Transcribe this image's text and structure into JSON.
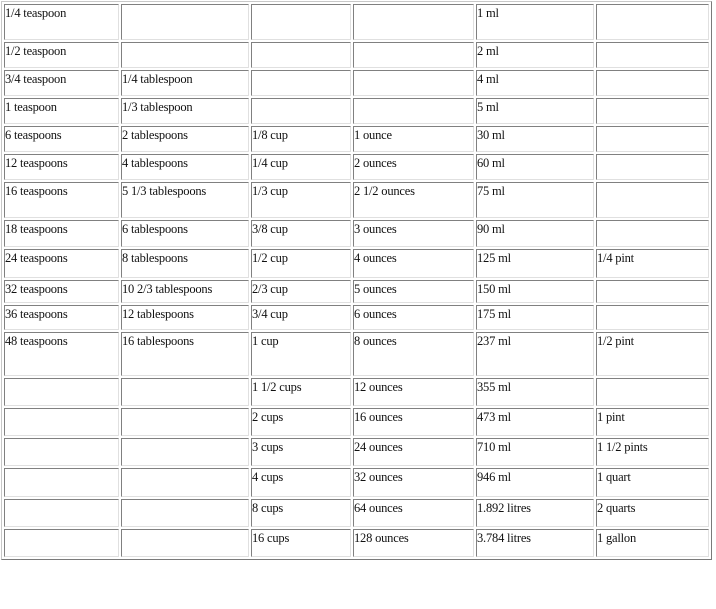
{
  "table": {
    "rows": [
      {
        "cells": [
          "1/4 teaspoon",
          "",
          "",
          "",
          "1 ml",
          ""
        ]
      },
      {
        "cells": [
          "1/2 teaspoon",
          "",
          "",
          "",
          "2 ml",
          ""
        ]
      },
      {
        "cells": [
          "3/4 teaspoon",
          "1/4 tablespoon",
          "",
          "",
          "4 ml",
          ""
        ]
      },
      {
        "cells": [
          "1 teaspoon",
          "1/3 tablespoon",
          "",
          "",
          "5 ml",
          ""
        ]
      },
      {
        "cells": [
          "6 teaspoons",
          "2 tablespoons",
          "1/8 cup",
          "1 ounce",
          "30 ml",
          ""
        ]
      },
      {
        "cells": [
          "12 teaspoons",
          "4 tablespoons",
          "1/4 cup",
          "2 ounces",
          "60 ml",
          ""
        ]
      },
      {
        "cells": [
          "16 teaspoons",
          "5 1/3 tablespoons",
          "1/3 cup",
          "2 1/2 ounces",
          "75 ml",
          ""
        ]
      },
      {
        "cells": [
          "18 teaspoons",
          "6 tablespoons",
          "3/8 cup",
          "3 ounces",
          "90 ml",
          ""
        ]
      },
      {
        "cells": [
          "24 teaspoons",
          "8 tablespoons",
          "1/2 cup",
          "4 ounces",
          "125 ml",
          "1/4 pint"
        ]
      },
      {
        "cells": [
          "32 teaspoons",
          "10 2/3 tablespoons",
          "2/3 cup",
          "5 ounces",
          "150 ml",
          ""
        ]
      },
      {
        "cells": [
          "36 teaspoons",
          "12 tablespoons",
          "3/4 cup",
          "6 ounces",
          "175 ml",
          ""
        ]
      },
      {
        "cells": [
          "48 teaspoons",
          "16 tablespoons",
          "1 cup",
          "8 ounces",
          "237 ml",
          "1/2 pint"
        ]
      },
      {
        "cells": [
          "",
          "",
          "1 1/2 cups",
          "12 ounces",
          "355 ml",
          ""
        ]
      },
      {
        "cells": [
          "",
          "",
          "2 cups",
          "16 ounces",
          "473 ml",
          "1 pint"
        ]
      },
      {
        "cells": [
          "",
          "",
          "3 cups",
          "24 ounces",
          "710 ml",
          "1 1/2 pints"
        ]
      },
      {
        "cells": [
          "",
          "",
          "4 cups",
          "32 ounces",
          "946 ml",
          "1 quart"
        ]
      },
      {
        "cells": [
          "",
          "",
          "8 cups",
          "64 ounces",
          "1.892 litres",
          "2 quarts"
        ]
      },
      {
        "cells": [
          "",
          "",
          "16 cups",
          "128 ounces",
          "3.784 litres",
          "1 gallon"
        ]
      }
    ]
  }
}
